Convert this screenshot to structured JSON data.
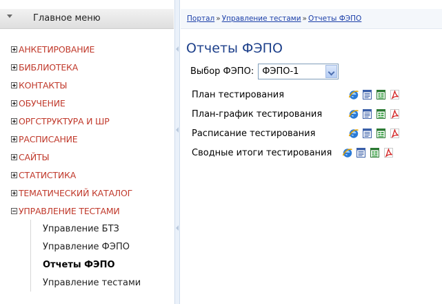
{
  "sidebar": {
    "header_title": "Главное меню",
    "items": [
      {
        "label": "АНКЕТИРОВАНИЕ",
        "expanded": false
      },
      {
        "label": "БИБЛИОТЕКА",
        "expanded": false
      },
      {
        "label": "КОНТАКТЫ",
        "expanded": false
      },
      {
        "label": "ОБУЧЕНИЕ",
        "expanded": false
      },
      {
        "label": "ОРГСТРУКТУРА И ШР",
        "expanded": false
      },
      {
        "label": "РАСПИСАНИЕ",
        "expanded": false
      },
      {
        "label": "САЙТЫ",
        "expanded": false
      },
      {
        "label": "СТАТИСТИКА",
        "expanded": false
      },
      {
        "label": "ТЕМАТИЧЕСКИЙ КАТАЛОГ",
        "expanded": false
      },
      {
        "label": "УПРАВЛЕНИЕ ТЕСТАМИ",
        "expanded": true
      }
    ],
    "subitems": [
      {
        "label": "Управление БТЗ",
        "active": false
      },
      {
        "label": "Управление ФЭПО",
        "active": false
      },
      {
        "label": "Отчеты ФЭПО",
        "active": true
      },
      {
        "label": "Управление тестами",
        "active": false
      }
    ]
  },
  "breadcrumb": {
    "items": [
      "Портал",
      "Управление тестами",
      "Отчеты ФЭПО"
    ],
    "separator": "»"
  },
  "main": {
    "title": "Отчеты ФЭПО",
    "select_label": "Выбор ФЭПО:",
    "select_value": "ФЭПО-1",
    "reports": [
      "План тестирования",
      "План-график тестирования",
      "Расписание тестирования",
      "Сводные итоги тестирования"
    ],
    "report_icons": [
      "ie-icon",
      "word-icon",
      "excel-icon",
      "pdf-icon"
    ]
  },
  "colors": {
    "menu_text": "#c0392b",
    "title": "#1c3f8a",
    "link": "#1a3ea8"
  }
}
